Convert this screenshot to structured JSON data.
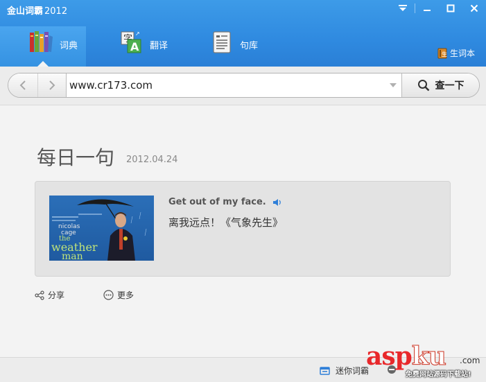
{
  "app": {
    "title_brand": "金山词霸",
    "title_year": "2012"
  },
  "window_controls": [
    "menu-dropdown",
    "minimize",
    "maximize",
    "close"
  ],
  "nav": {
    "tabs": [
      {
        "label": "词典",
        "icon": "books-icon",
        "active": true
      },
      {
        "label": "翻译",
        "icon": "translate-icon",
        "active": false
      },
      {
        "label": "句库",
        "icon": "document-icon",
        "active": false
      }
    ],
    "wordbook_label": "生词本"
  },
  "search": {
    "value": "www.cr173.com",
    "button_label": "查一下"
  },
  "daily": {
    "title": "每日一句",
    "date": "2012.04.24",
    "sentence_en": "Get out of my face.",
    "sentence_cn": "离我远点！《气象先生》",
    "poster_text": {
      "line1": "nicolas",
      "line2": "cage",
      "line3": "the",
      "line4": "weather",
      "line5": "man"
    }
  },
  "actions": {
    "share_label": "分享",
    "more_label": "更多"
  },
  "footer": {
    "mini_label": "迷你词霸"
  },
  "watermark": {
    "main_a": "asp",
    "main_b": "ku",
    "com": ".com",
    "sub": "免费网站源码下载站!"
  },
  "colors": {
    "header_blue": "#2f8ae0",
    "accent_red": "#e8282b"
  }
}
